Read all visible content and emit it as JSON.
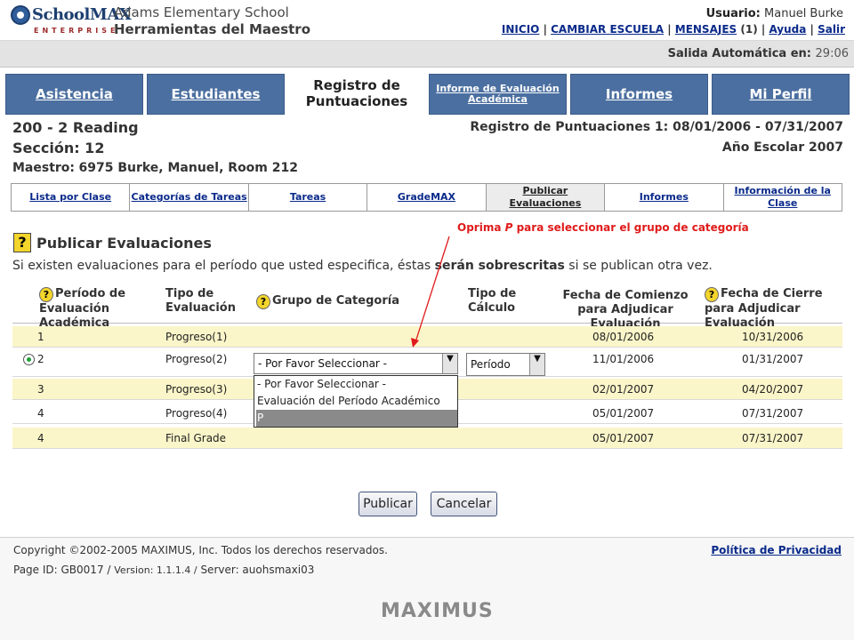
{
  "app": {
    "logo_name": "SchoolMAX",
    "logo_sub": "ENTERPRISE",
    "school_name": "Adams Elementary School",
    "tool_name": "Herramientas del Maestro"
  },
  "user": {
    "label": "Usuario:",
    "name": "Manuel Burke"
  },
  "top_links": {
    "home": "INICIO",
    "change_school": "CAMBIAR ESCUELA",
    "messages": "MENSAJES",
    "messages_count": "(1)",
    "help": "Ayuda",
    "logout": "Salir"
  },
  "session": {
    "label": "Salida Automática en:",
    "time": "29:06"
  },
  "tabs": [
    {
      "label": "Asistencia",
      "active": false
    },
    {
      "label": "Estudiantes",
      "active": false
    },
    {
      "label": "Registro de Puntuaciones",
      "active": true
    },
    {
      "label": "Informe de Evaluación Académica",
      "active": false
    },
    {
      "label": "Informes",
      "active": false
    },
    {
      "label": "Mi Perfil",
      "active": false
    }
  ],
  "class_info": {
    "course": "200 - 2 Reading",
    "section": "Sección: 12",
    "teacher_label": "Maestro:",
    "teacher_value": "6975 Burke, Manuel, Room 212",
    "gradebook_title": "Registro de Puntuaciones 1: 08/01/2006 - 07/31/2007",
    "school_year": "Año Escolar 2007"
  },
  "subnav": [
    {
      "label": "Lista por Clase",
      "active": false
    },
    {
      "label": "Categorías de Tareas",
      "active": false
    },
    {
      "label": "Tareas",
      "active": false
    },
    {
      "label": "GradeMAX",
      "active": false
    },
    {
      "label": "Publicar Evaluaciones",
      "active": true
    },
    {
      "label": "Informes",
      "active": false
    },
    {
      "label": "Información de la Clase",
      "active": false
    }
  ],
  "page": {
    "help_glyph": "?",
    "title": "Publicar Evaluaciones",
    "warning_start": "Si existen evaluaciones para el período que usted especifica, éstas ",
    "warning_bold": "serán sobrescritas",
    "warning_end": " si se publican otra vez."
  },
  "instruction": {
    "before": "Oprima ",
    "key": "P",
    "after": " para seleccionar el grupo de categoría"
  },
  "columns": {
    "period": "Período de Evaluación Académica",
    "type": "Tipo de Evaluación",
    "group": "Grupo de Categoría",
    "calc": "Tipo de Cálculo",
    "start": "Fecha de Comienzo para Adjudicar Evaluación",
    "end": "Fecha de Cierre para Adjudicar Evaluación"
  },
  "rows": [
    {
      "period": "1",
      "type": "Progreso(1)",
      "start": "08/01/2006",
      "end": "10/31/2006"
    },
    {
      "period": "2",
      "type": "Progreso(2)",
      "start": "11/01/2006",
      "end": "01/31/2007"
    },
    {
      "period": "3",
      "type": "Progreso(3)",
      "start": "02/01/2007",
      "end": "04/20/2007"
    },
    {
      "period": "4",
      "type": "Progreso(4)",
      "start": "05/01/2007",
      "end": "07/31/2007"
    },
    {
      "period": "4",
      "type": "Final Grade",
      "start": "05/01/2007",
      "end": "07/31/2007"
    }
  ],
  "selected_row": {
    "group_value": "- Por Favor Seleccionar -",
    "calc_value": "Período"
  },
  "group_options": [
    "- Por Favor Seleccionar -",
    "Evaluación del Período Académico",
    "P"
  ],
  "buttons": {
    "publish": "Publicar",
    "cancel": "Cancelar"
  },
  "footer": {
    "copyright": "Copyright ©2002-2005 MAXIMUS, Inc. Todos los derechos reservados.",
    "privacy": "Política de Privacidad",
    "page_id": "Page ID: GB0017 /",
    "version": "Version: 1.1.1.4 /",
    "server": "Server: auohsmaxi03",
    "vendor": "MAXIMUS"
  },
  "colors": {
    "tab_blue": "#4b6fa0",
    "row_yellow": "#fbf6c9",
    "instruction_red": "#e01b1b",
    "link_blue": "#0a2a8a"
  }
}
